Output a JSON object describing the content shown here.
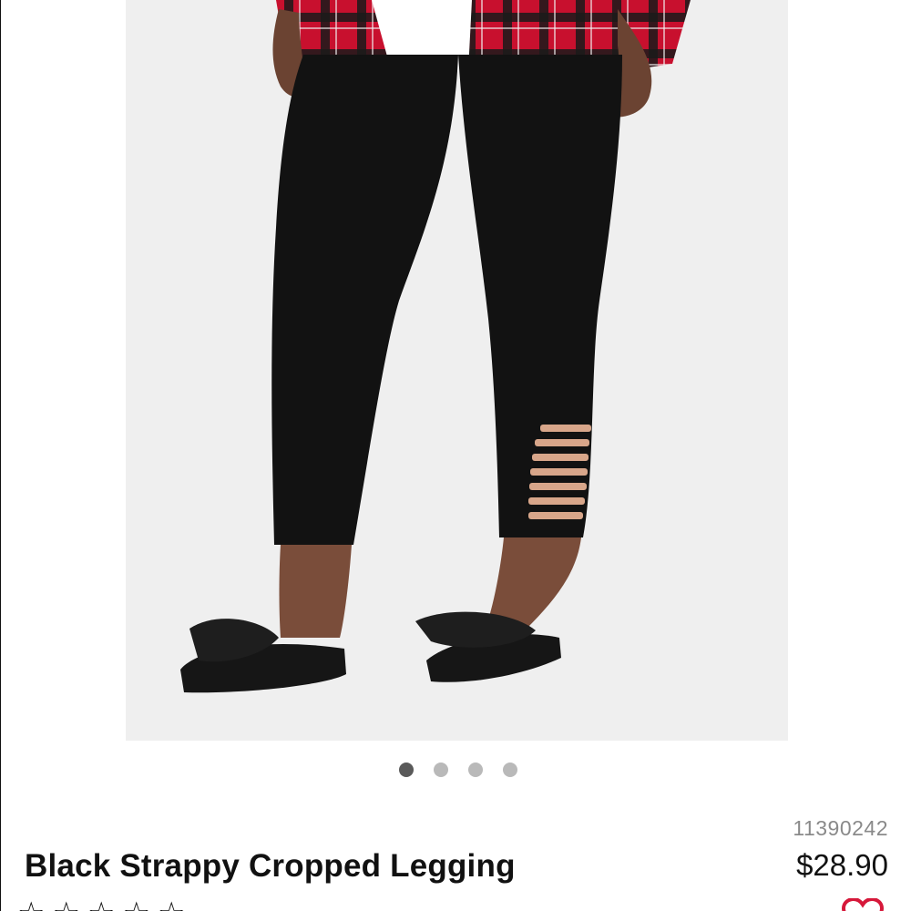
{
  "product": {
    "image_alt": "Black Strappy Cropped Legging",
    "sku": "11390242",
    "title": "Black Strappy Cropped Legging",
    "price": "$28.90",
    "rating_stars": 5
  },
  "carousel": {
    "total": 4,
    "active_index": 0
  },
  "icons": {
    "wishlist": "heart-icon",
    "star": "star-icon"
  },
  "colors": {
    "image_background": "#efefef",
    "dot_active": "#5a5a5a",
    "dot_inactive": "#b9b9b9",
    "sku_text": "#8a8a8a",
    "heart": "#d6183a"
  }
}
